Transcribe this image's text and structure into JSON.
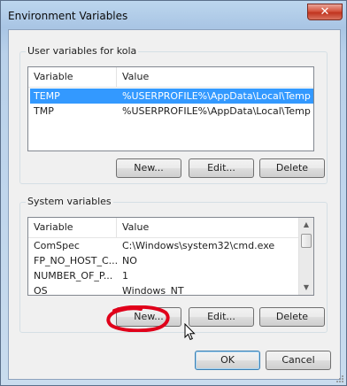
{
  "window": {
    "title": "Environment Variables",
    "close_glyph": "✕"
  },
  "user_vars": {
    "group_label": "User variables for kola",
    "columns": [
      "Variable",
      "Value"
    ],
    "rows": [
      {
        "variable": "TEMP",
        "value": "%USERPROFILE%\\AppData\\Local\\Temp",
        "selected": true
      },
      {
        "variable": "TMP",
        "value": "%USERPROFILE%\\AppData\\Local\\Temp",
        "selected": false
      }
    ],
    "buttons": {
      "new": "New...",
      "edit": "Edit...",
      "delete": "Delete"
    }
  },
  "system_vars": {
    "group_label": "System variables",
    "columns": [
      "Variable",
      "Value"
    ],
    "rows": [
      {
        "variable": "ComSpec",
        "value": "C:\\Windows\\system32\\cmd.exe"
      },
      {
        "variable": "FP_NO_HOST_C...",
        "value": "NO"
      },
      {
        "variable": "NUMBER_OF_P...",
        "value": "1"
      },
      {
        "variable": "OS",
        "value": "Windows_NT"
      }
    ],
    "buttons": {
      "new": "New...",
      "edit": "Edit...",
      "delete": "Delete"
    }
  },
  "footer": {
    "ok": "OK",
    "cancel": "Cancel"
  },
  "icons": {
    "close": "close-icon",
    "scroll_up": "scroll-up-arrow-icon",
    "scroll_down": "scroll-down-arrow-icon",
    "cursor": "mouse-pointer-icon",
    "annotation": "red-circle-annotation"
  },
  "colors": {
    "selection": "#3399ff",
    "annotation": "#e0001a",
    "title_gradient_top": "#bcd6ee"
  }
}
